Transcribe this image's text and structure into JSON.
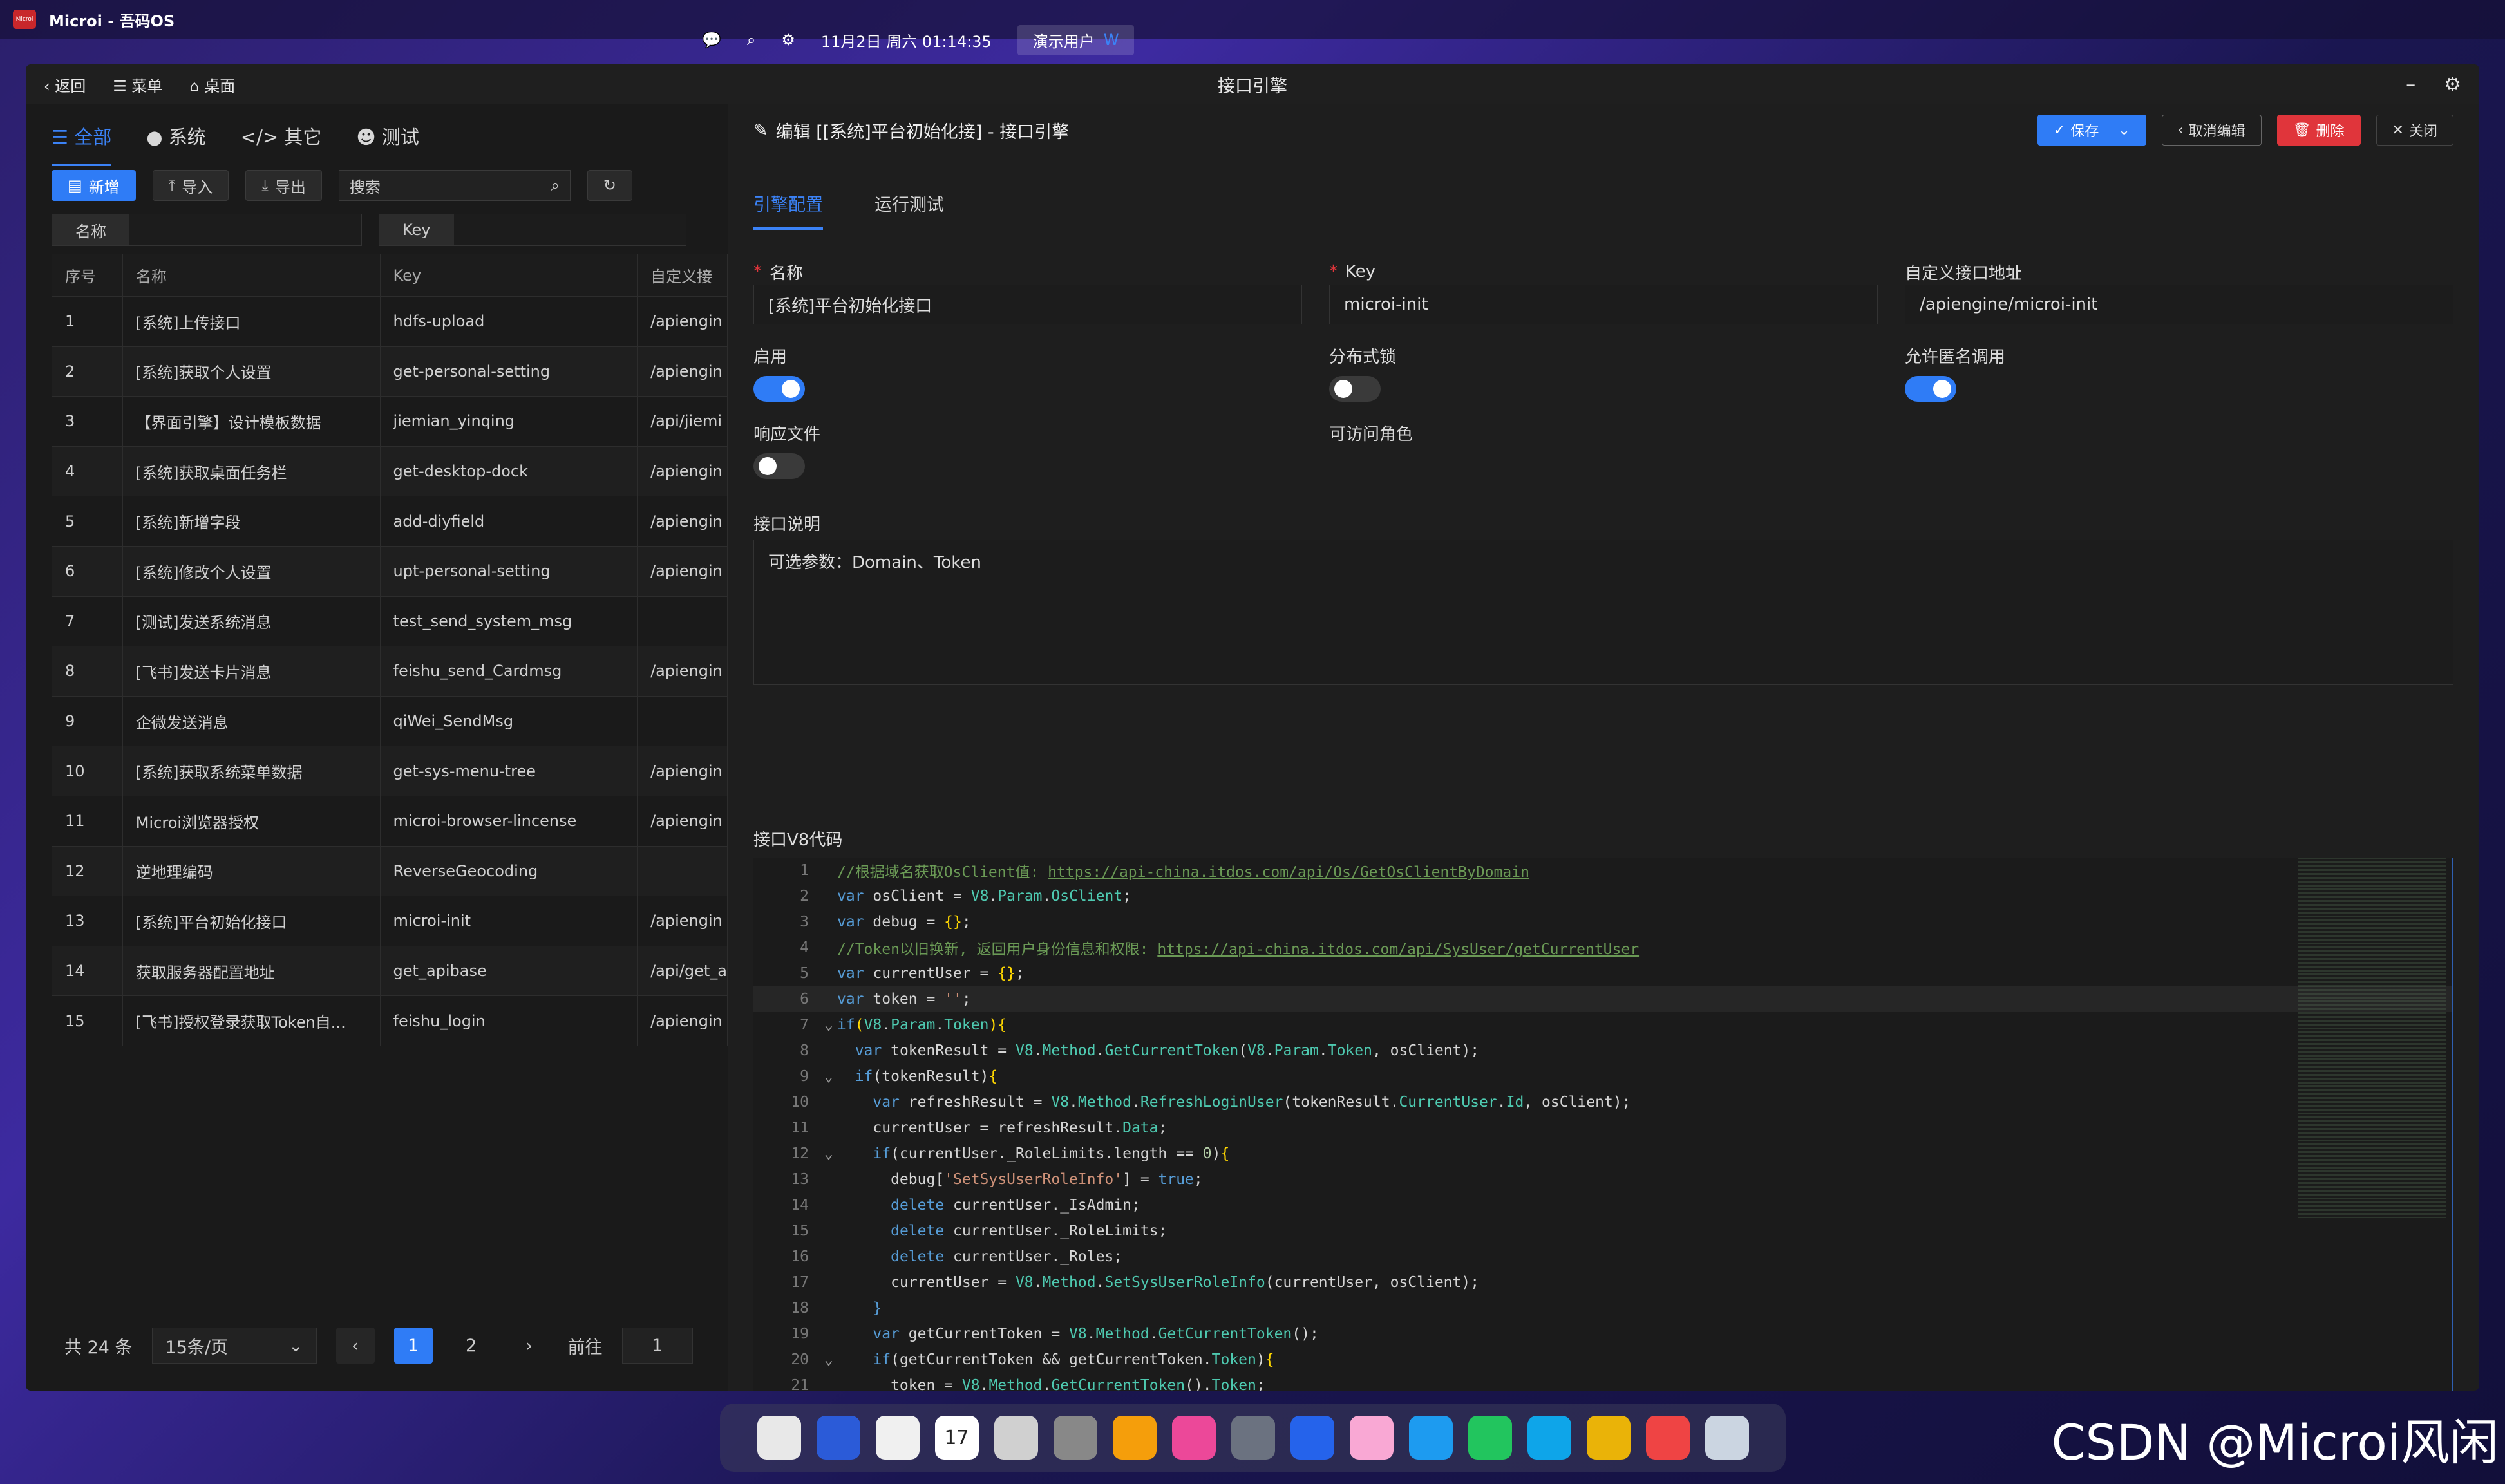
{
  "topbar": {
    "app": "Microi - 吾码OS",
    "logo": "Microi",
    "datetime": "11月2日 周六 01:14:35",
    "user": "演示用户"
  },
  "window": {
    "title": "接口引擎",
    "back": "返回",
    "menu": "菜单",
    "desktop": "桌面"
  },
  "left": {
    "tabs": [
      "全部",
      "系统",
      "其它",
      "测试"
    ],
    "buttons": {
      "add": "新增",
      "import": "导入",
      "export": "导出",
      "refresh": "↻"
    },
    "search_placeholder": "搜索",
    "filters": [
      "名称",
      "Key"
    ],
    "columns": [
      "序号",
      "名称",
      "Key",
      "自定义接"
    ],
    "rows": [
      [
        "1",
        "[系统]上传接口",
        "hdfs-upload",
        "/apiengin"
      ],
      [
        "2",
        "[系统]获取个人设置",
        "get-personal-setting",
        "/apiengin"
      ],
      [
        "3",
        "【界面引擎】设计模板数据",
        "jiemian_yinqing",
        "/api/jiemi"
      ],
      [
        "4",
        "[系统]获取桌面任务栏",
        "get-desktop-dock",
        "/apiengin"
      ],
      [
        "5",
        "[系统]新增字段",
        "add-diyfield",
        "/apiengin"
      ],
      [
        "6",
        "[系统]修改个人设置",
        "upt-personal-setting",
        "/apiengin"
      ],
      [
        "7",
        "[测试]发送系统消息",
        "test_send_system_msg",
        ""
      ],
      [
        "8",
        "[飞书]发送卡片消息",
        "feishu_send_Cardmsg",
        "/apiengin"
      ],
      [
        "9",
        "企微发送消息",
        "qiWei_SendMsg",
        ""
      ],
      [
        "10",
        "[系统]获取系统菜单数据",
        "get-sys-menu-tree",
        "/apiengin"
      ],
      [
        "11",
        "Microi浏览器授权",
        "microi-browser-lincense",
        "/apiengin"
      ],
      [
        "12",
        "逆地理编码",
        "ReverseGeocoding",
        ""
      ],
      [
        "13",
        "[系统]平台初始化接口",
        "microi-init",
        "/apiengin"
      ],
      [
        "14",
        "获取服务器配置地址",
        "get_apibase",
        "/api/get_a"
      ],
      [
        "15",
        "[飞书]授权登录获取Token自...",
        "feishu_login",
        "/apiengin"
      ]
    ],
    "pager": {
      "total": "共 24 条",
      "size": "15条/页",
      "pages": [
        "1",
        "2"
      ],
      "goto": "前往",
      "goto_val": "1"
    }
  },
  "right": {
    "header": "编辑 [[系统]平台初始化接] - 接口引擎",
    "buttons": {
      "save": "保存",
      "cancel": "取消编辑",
      "delete": "删除",
      "close": "关闭"
    },
    "tabs": [
      "引擎配置",
      "运行测试"
    ],
    "fields": {
      "name_label": "名称",
      "name_value": "[系统]平台初始化接口",
      "key_label": "Key",
      "key_value": "microi-init",
      "url_label": "自定义接口地址",
      "url_value": "/apiengine/microi-init"
    },
    "switches": {
      "enable": "启用",
      "lock": "分布式锁",
      "anon": "允许匿名调用",
      "resp": "响应文件",
      "roles": "可访问角色"
    },
    "desc_label": "接口说明",
    "desc_value": "可选参数：Domain、Token",
    "code_label": "接口V8代码"
  },
  "dock_icons": [
    "pen-icon",
    "word-icon",
    "notes-icon",
    "calendar-icon",
    "script-icon",
    "settings-icon",
    "photos-icon",
    "people-icon",
    "system-icon",
    "cube-icon",
    "avatar-icon",
    "appstore-icon",
    "palette-icon",
    "globe-icon",
    "chrome-icon",
    "apps-icon",
    "trash-icon"
  ],
  "calendar_day": "17",
  "watermark": "CSDN @Microi风闲"
}
